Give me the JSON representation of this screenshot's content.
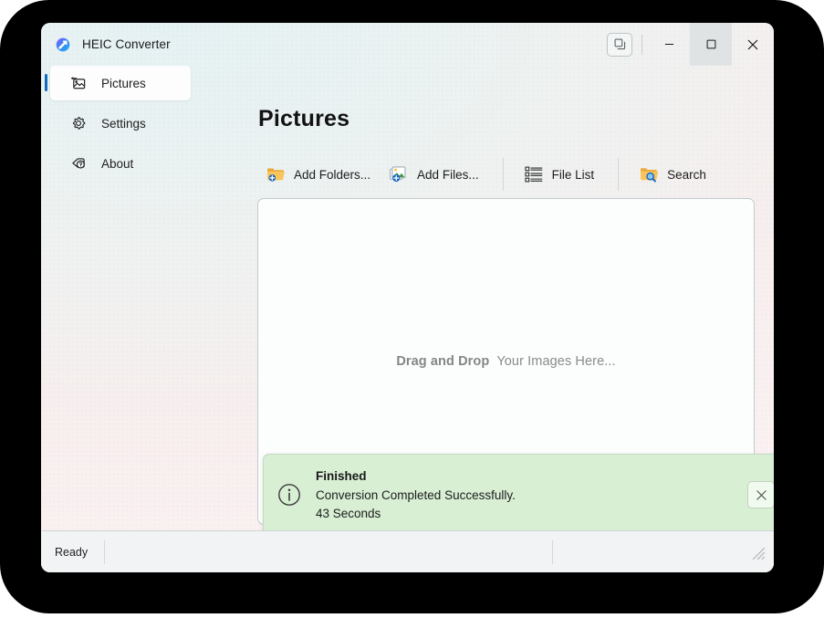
{
  "window": {
    "app_title": "HEIC Converter",
    "app_icon": "pill-pen-icon",
    "caption": {
      "restore_pane_label": "restore-pane-icon",
      "minimize_label": "minimize-icon",
      "maximize_label": "maximize-icon",
      "close_label": "close-icon"
    }
  },
  "sidebar": {
    "items": [
      {
        "label": "Pictures",
        "icon": "pictures-icon",
        "selected": true
      },
      {
        "label": "Settings",
        "icon": "gear-icon",
        "selected": false
      },
      {
        "label": "About",
        "icon": "about-icon",
        "selected": false
      }
    ]
  },
  "main": {
    "page_title": "Pictures",
    "toolbar": [
      {
        "label": "Add Folders...",
        "icon": "folder-add-icon"
      },
      {
        "label": "Add Files...",
        "icon": "image-add-icon"
      },
      {
        "label": "File List",
        "icon": "file-list-icon"
      },
      {
        "label": "Search",
        "icon": "folder-search-icon"
      }
    ],
    "drop_zone": {
      "text_strong": "Drag and Drop",
      "text_normal": "Your Images Here..."
    }
  },
  "notification": {
    "icon": "info-circle-icon",
    "title": "Finished",
    "message": "Conversion Completed Successfully.",
    "duration": "43 Seconds",
    "close_icon": "close-icon",
    "background_color": "#d8efd4",
    "border_color": "#c5d9c2"
  },
  "status_bar": {
    "text": "Ready",
    "resize_grip": "resize-grip-icon"
  },
  "colors": {
    "accent": "#0f6cbd",
    "folder_yellow": "#f7b731",
    "success_green": "#d8efd4",
    "window_background": "#eef4f6"
  }
}
